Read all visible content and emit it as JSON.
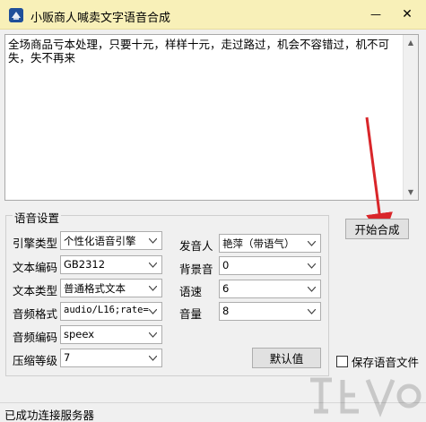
{
  "window": {
    "title": "小贩商人喊卖文字语音合成",
    "min_symbol": "—",
    "close_symbol": "✕"
  },
  "editor": {
    "text": "全场商品亏本处理，只要十元，样样十元，走过路过，机会不容错过，机不可失，失不再来"
  },
  "actions": {
    "start_label": "开始合成",
    "default_label": "默认值",
    "save_audio_label": "保存语音文件",
    "save_audio_checked": false
  },
  "settings": {
    "group_title": "语音设置",
    "engine_type": {
      "label": "引擎类型",
      "value": "个性化语音引擎"
    },
    "text_encoding": {
      "label": "文本编码",
      "value": "GB2312"
    },
    "text_type": {
      "label": "文本类型",
      "value": "普通格式文本"
    },
    "audio_format": {
      "label": "音频格式",
      "value": "audio/L16;rate="
    },
    "audio_codec": {
      "label": "音频编码",
      "value": "speex"
    },
    "compression_level": {
      "label": "压缩等级",
      "value": "7"
    },
    "speaker": {
      "label": "发音人",
      "value": "艳萍（带语气）"
    },
    "background_sound": {
      "label": "背景音",
      "value": "0"
    },
    "speed": {
      "label": "语速",
      "value": "6"
    },
    "volume": {
      "label": "音量",
      "value": "8"
    }
  },
  "status": {
    "text": "已成功连接服务器"
  },
  "colors": {
    "titlebar_bg": "#f8f0b8",
    "arrow_red": "#d9262a",
    "icon_blue": "#1f4f9a"
  },
  "icons": {
    "arrow": "red-arrow-annotation",
    "app": "app-icon",
    "dropdown": "chevron-down-icon"
  }
}
